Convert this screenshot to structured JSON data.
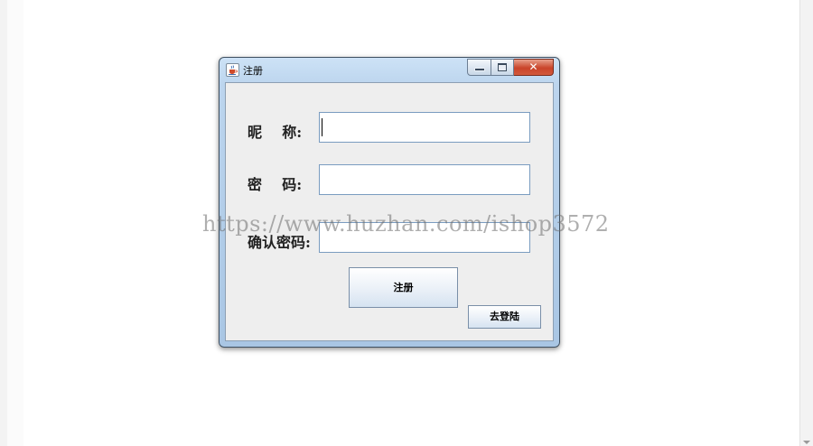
{
  "window": {
    "title": "注册",
    "controls": {
      "minimize": "minimize",
      "maximize": "maximize",
      "close": "close"
    }
  },
  "form": {
    "nickname_label": "昵    称:",
    "password_label": "密    码:",
    "confirm_label": "确认密码:",
    "nickname_value": "",
    "password_value": "",
    "confirm_value": ""
  },
  "buttons": {
    "register": "注册",
    "go_login": "去登陆"
  },
  "watermark": "https://www.huzhan.com/ishop3572",
  "icons": [
    "java-cup-icon",
    "minimize-icon",
    "maximize-icon",
    "close-icon",
    "scroll-down-icon"
  ],
  "colors": {
    "titlebar": "#bcd5ee",
    "close": "#c9442a",
    "client": "#eeeeee"
  }
}
